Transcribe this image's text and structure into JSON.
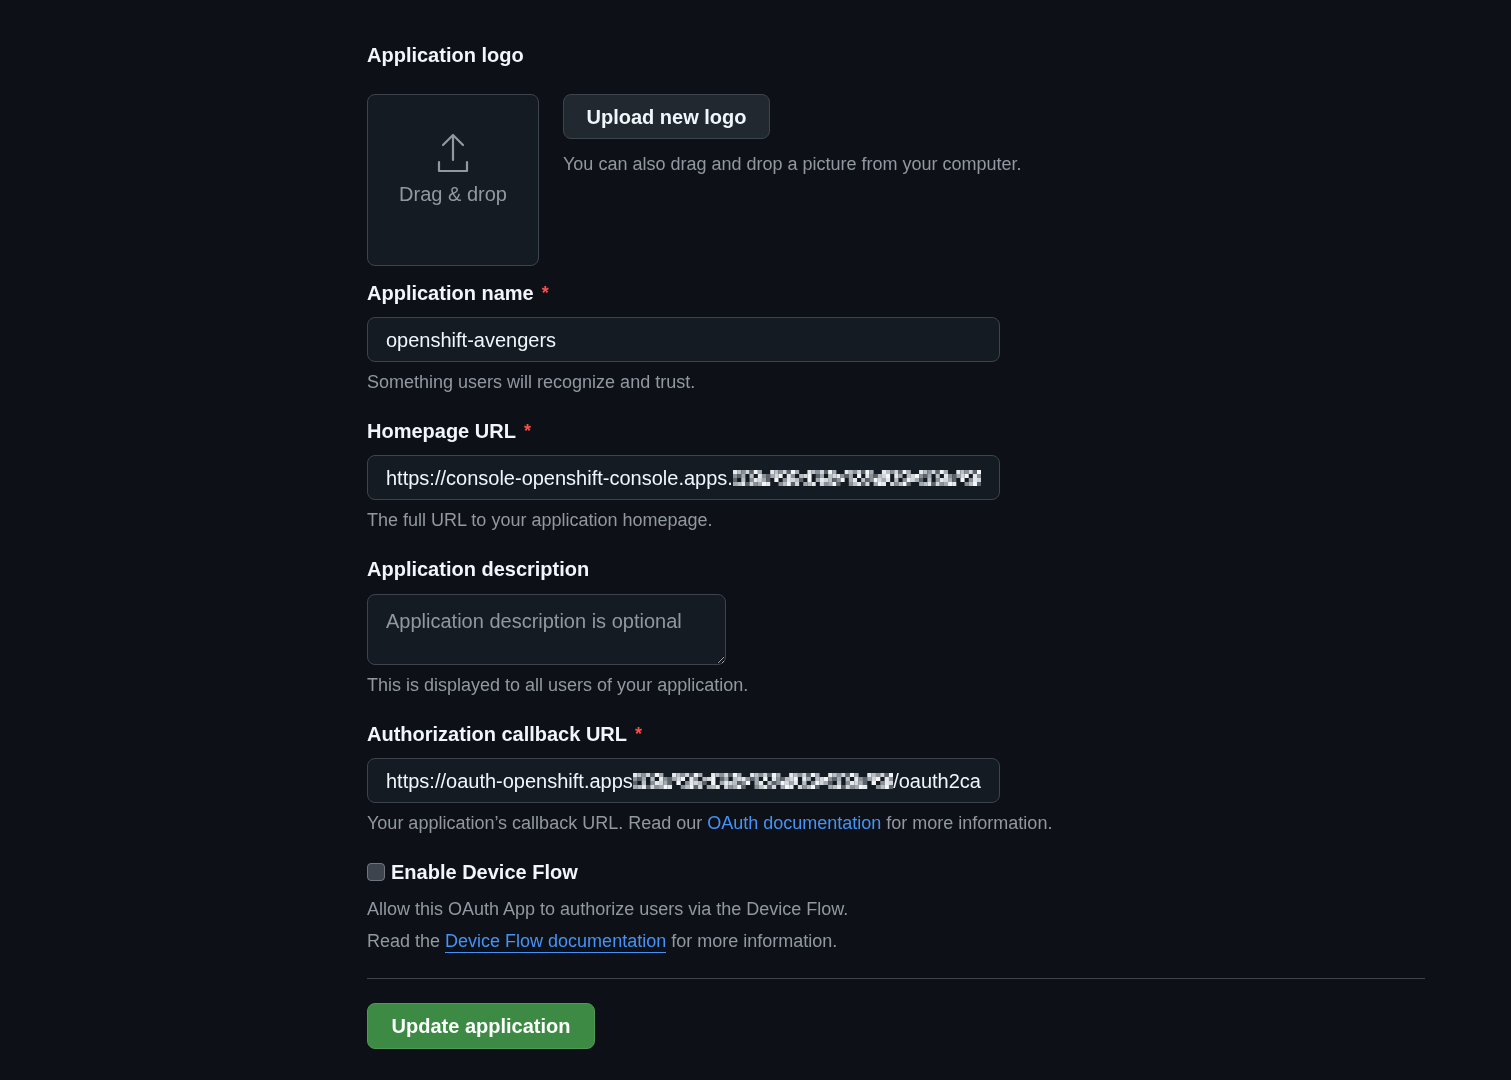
{
  "logo": {
    "label": "Application logo",
    "dropzone_text": "Drag & drop",
    "upload_button": "Upload new logo",
    "hint": "You can also drag and drop a picture from your computer."
  },
  "fields": [
    {
      "kind": "input",
      "label": "Application name",
      "required_mark": "*",
      "value": [
        {
          "kind": "text",
          "text": "openshift-avengers"
        }
      ],
      "hint": [
        {
          "kind": "text",
          "text": "Something users will recognize and trust."
        }
      ]
    },
    {
      "kind": "input",
      "label": "Homepage URL",
      "required_mark": "*",
      "value": [
        {
          "kind": "text",
          "text": "https://console-openshift-console.apps."
        },
        {
          "kind": "redacted"
        }
      ],
      "hint": [
        {
          "kind": "text",
          "text": "The full URL to your application homepage."
        }
      ]
    },
    {
      "kind": "textarea",
      "label": "Application description",
      "placeholder": "Application description is optional",
      "hint": [
        {
          "kind": "text",
          "text": "This is displayed to all users of your application."
        }
      ]
    },
    {
      "kind": "input",
      "label": "Authorization callback URL",
      "required_mark": "*",
      "value": [
        {
          "kind": "text",
          "text": "https://oauth-openshift.apps"
        },
        {
          "kind": "redacted"
        },
        {
          "kind": "text",
          "text": "/oauth2ca"
        }
      ],
      "hint": [
        {
          "kind": "text",
          "text": "Your application’s callback URL. Read our "
        },
        {
          "kind": "link",
          "text": "OAuth documentation",
          "underlined": false
        },
        {
          "kind": "text",
          "text": " for more information."
        }
      ]
    }
  ],
  "device_flow": {
    "label": "Enable Device Flow",
    "checked": false,
    "description": [
      {
        "kind": "text",
        "text": "Allow this OAuth App to authorize users via the Device Flow."
      }
    ],
    "note": [
      {
        "kind": "text",
        "text": "Read the "
      },
      {
        "kind": "link",
        "text": "Device Flow documentation",
        "underlined": true
      },
      {
        "kind": "text",
        "text": " for more information."
      }
    ]
  },
  "submit_button": "Update application"
}
